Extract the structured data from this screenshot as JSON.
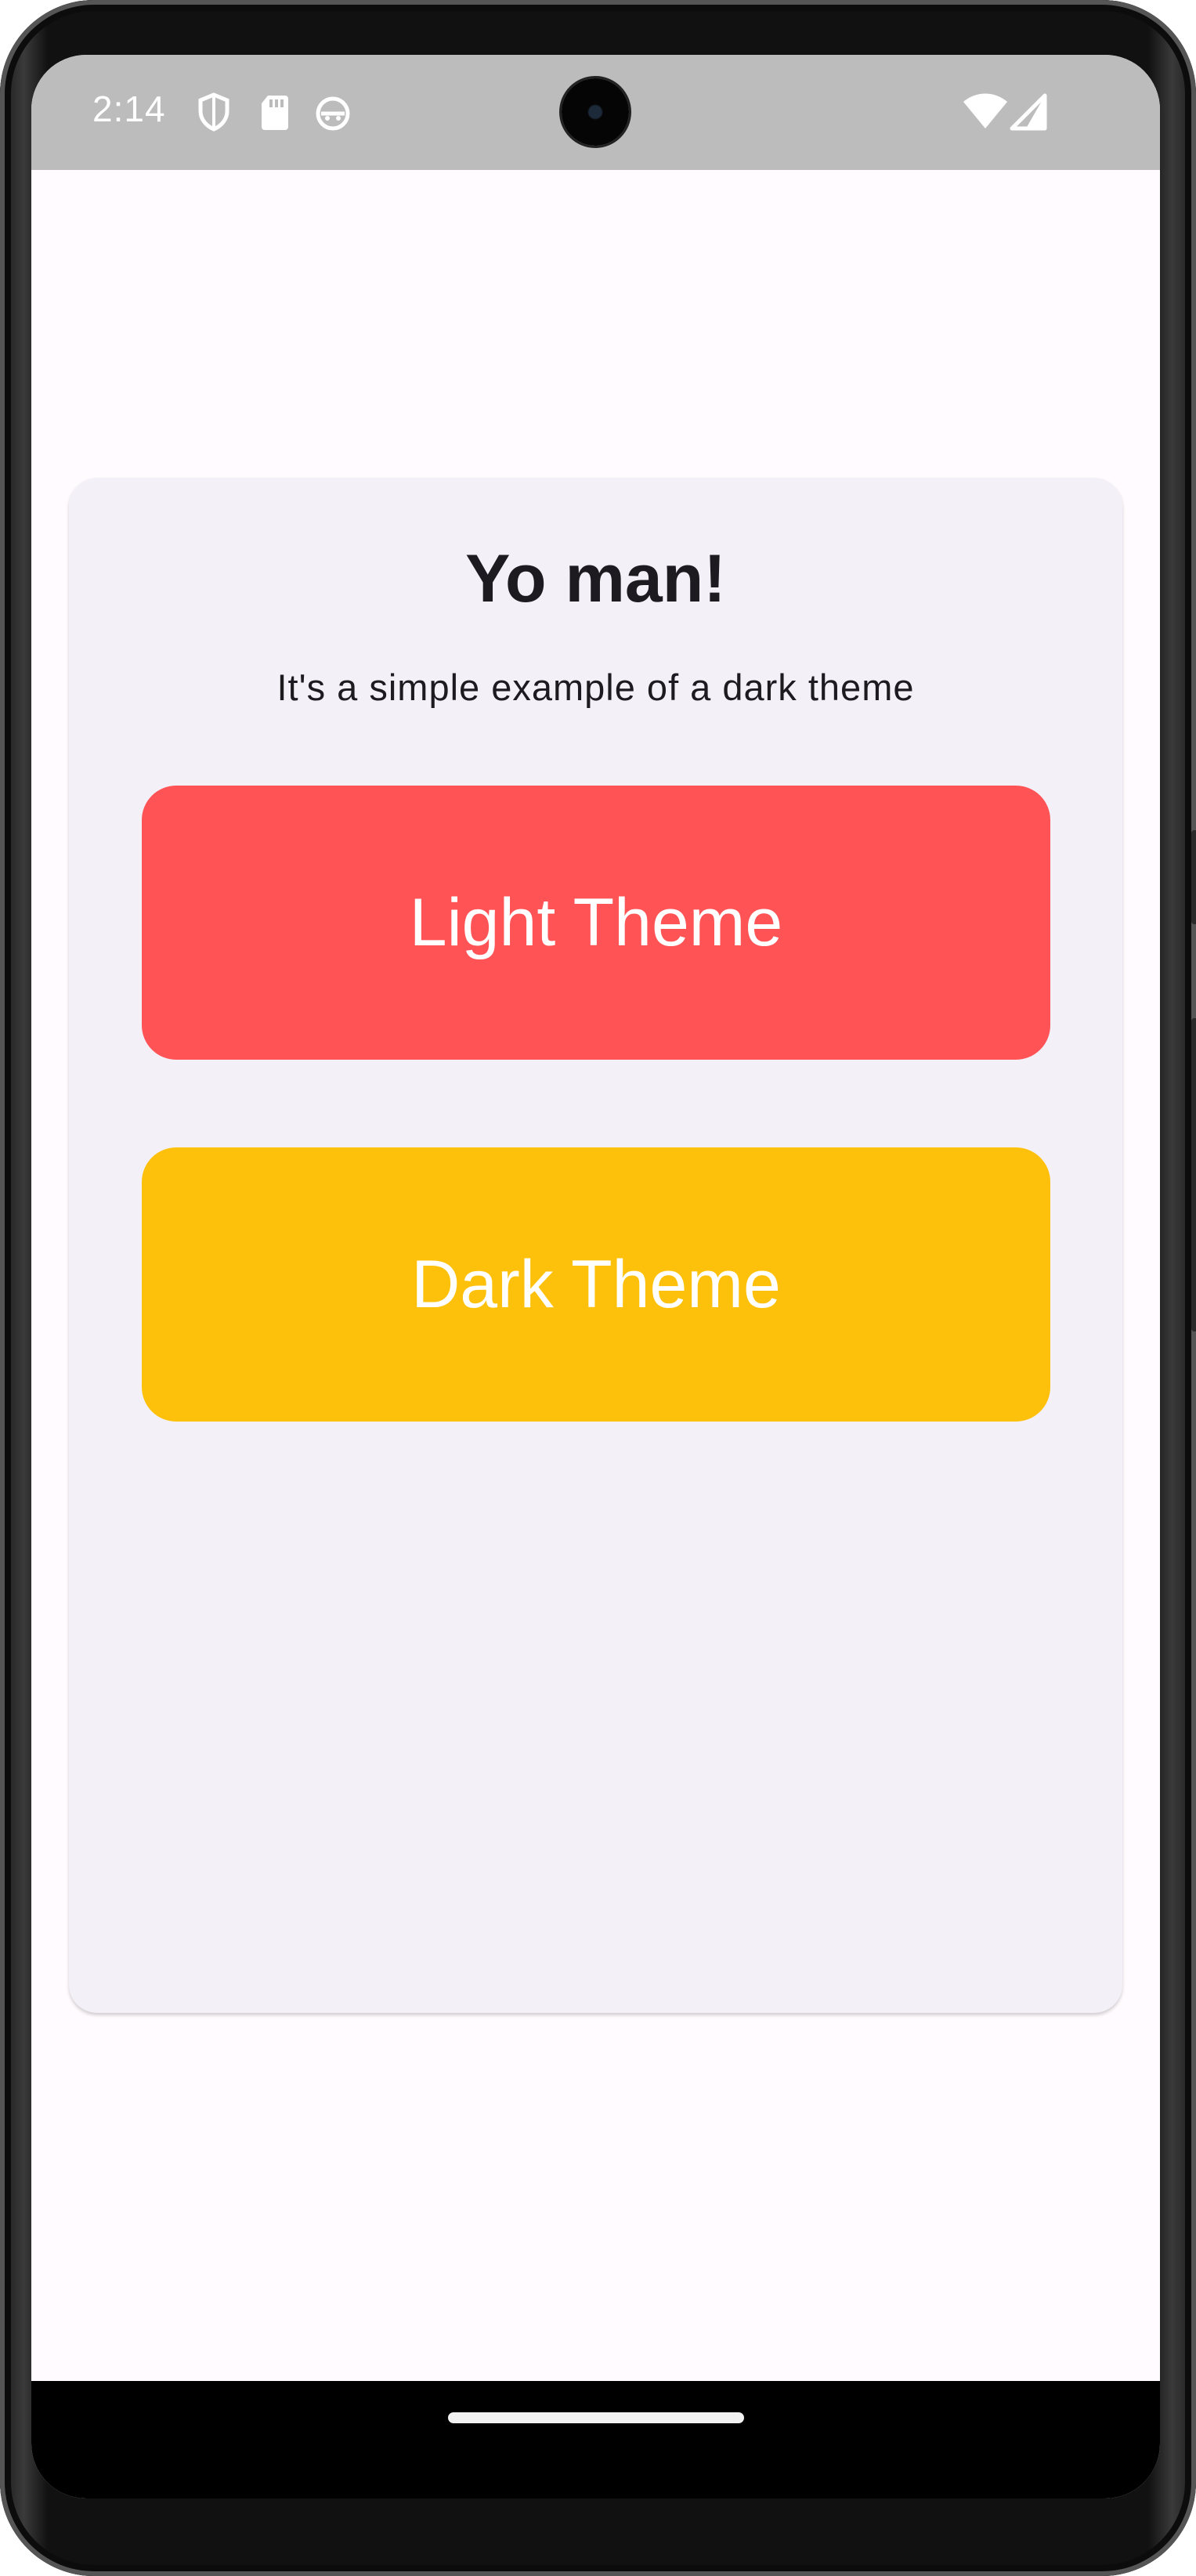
{
  "status_bar": {
    "time": "2:14",
    "icons": [
      "shield-icon",
      "sd-card-icon",
      "android-face-icon",
      "wifi-icon",
      "cell-signal-icon"
    ]
  },
  "card": {
    "title": "Yo man!",
    "subtitle": "It's a simple example of a dark theme"
  },
  "buttons": {
    "light_label": "Light Theme",
    "dark_label": "Dark Theme"
  },
  "colors": {
    "light_button": "#ff5356",
    "dark_button": "#fdc10c",
    "background": "#fffbfe",
    "card": "#f4f0f7",
    "status_bar": "#bdbcbc"
  }
}
